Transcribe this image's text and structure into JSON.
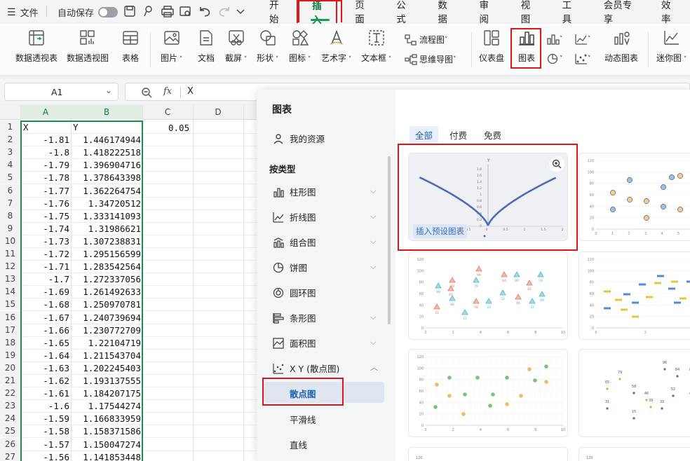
{
  "menubar": {
    "menu": "文件",
    "autosave": "自动保存"
  },
  "tabs": [
    "开始",
    "插入",
    "页面",
    "公式",
    "数据",
    "审阅",
    "视图",
    "工具",
    "会员专享",
    "效率"
  ],
  "ribbon": {
    "pivot_table": "数据透视表",
    "pivot_chart": "数据透视图",
    "table": "表格",
    "picture": "图片",
    "document": "文档",
    "screenshot": "截屏",
    "shape": "形状",
    "icon": "图标",
    "wordart": "艺术字",
    "textbox": "文本框",
    "flowchart": "流程图",
    "mindmap": "思维导图",
    "dashboard": "仪表盘",
    "chart": "图表",
    "dynamic_chart": "动态图表",
    "sparkline": "迷你图"
  },
  "formula_bar": {
    "cell_ref": "A1",
    "fx": "fx",
    "content": "X"
  },
  "sheet": {
    "col_headers": [
      "A",
      "B",
      "C",
      "D"
    ],
    "c1": "0.05",
    "rows": [
      {
        "n": "1",
        "a": "X",
        "b": "Y"
      },
      {
        "n": "2",
        "a": "-1.81",
        "b": "1.446174944"
      },
      {
        "n": "3",
        "a": "-1.8",
        "b": "1.418222518"
      },
      {
        "n": "4",
        "a": "-1.79",
        "b": "1.396904716"
      },
      {
        "n": "5",
        "a": "-1.78",
        "b": "1.378643398"
      },
      {
        "n": "6",
        "a": "-1.77",
        "b": "1.362264754"
      },
      {
        "n": "7",
        "a": "-1.76",
        "b": "1.34720512"
      },
      {
        "n": "8",
        "a": "-1.75",
        "b": "1.333141093"
      },
      {
        "n": "9",
        "a": "-1.74",
        "b": "1.31986621"
      },
      {
        "n": "10",
        "a": "-1.73",
        "b": "1.307238831"
      },
      {
        "n": "11",
        "a": "-1.72",
        "b": "1.295156599"
      },
      {
        "n": "12",
        "a": "-1.71",
        "b": "1.283542564"
      },
      {
        "n": "13",
        "a": "-1.7",
        "b": "1.272337056"
      },
      {
        "n": "14",
        "a": "-1.69",
        "b": "1.261492633"
      },
      {
        "n": "15",
        "a": "-1.68",
        "b": "1.250970781"
      },
      {
        "n": "16",
        "a": "-1.67",
        "b": "1.240739694"
      },
      {
        "n": "17",
        "a": "-1.66",
        "b": "1.230772709"
      },
      {
        "n": "18",
        "a": "-1.65",
        "b": "1.22104719"
      },
      {
        "n": "19",
        "a": "-1.64",
        "b": "1.211543704"
      },
      {
        "n": "20",
        "a": "-1.63",
        "b": "1.202245403"
      },
      {
        "n": "21",
        "a": "-1.62",
        "b": "1.193137555"
      },
      {
        "n": "22",
        "a": "-1.61",
        "b": "1.184207175"
      },
      {
        "n": "23",
        "a": "-1.6",
        "b": "1.17544274"
      },
      {
        "n": "24",
        "a": "-1.59",
        "b": "1.166833959"
      },
      {
        "n": "25",
        "a": "-1.58",
        "b": "1.158371586"
      },
      {
        "n": "26",
        "a": "-1.57",
        "b": "1.150047274"
      },
      {
        "n": "27",
        "a": "-1.56",
        "b": "1.141853448"
      }
    ]
  },
  "panel": {
    "title": "图表",
    "my_resources": "我的资源",
    "by_type": "按类型",
    "types": [
      "柱形图",
      "折线图",
      "组合图",
      "饼图",
      "圆环图",
      "条形图",
      "面积图"
    ],
    "xy_group": "X Y (散点图)",
    "xy_sub": [
      "散点图",
      "平滑线",
      "直线"
    ],
    "filters": [
      "全部",
      "付费",
      "免费"
    ],
    "insert_preset": "插入预设图表",
    "preview_title": "Y",
    "preview_yticks": [
      "1.8",
      "1.6",
      "1.4",
      "1.2",
      "1",
      "0.8",
      "0.6",
      "0.4",
      "0.2",
      "0"
    ],
    "preview_xticks": [
      "-1.5",
      "-1",
      "-0.5",
      "0",
      "0.5",
      "1",
      "1.5",
      "2"
    ],
    "thumb2": {
      "yticks": [
        "120",
        "100",
        "80",
        "60",
        "40",
        "20",
        "0"
      ],
      "xticks": [
        "0",
        "1",
        "2",
        "3",
        "4",
        "5",
        "6"
      ]
    },
    "thumb3": {
      "yticks": [
        "120",
        "100",
        "80",
        "60",
        "40",
        "20",
        "0"
      ],
      "xticks": [
        "0",
        "2",
        "4",
        "6",
        "8",
        "10"
      ],
      "tri_labels": [
        "88",
        "78",
        "46",
        "79",
        "96",
        "84",
        "80",
        "74",
        "82",
        "31",
        "58",
        "52",
        "46",
        "37",
        "33",
        "15",
        "49",
        "65"
      ]
    },
    "thumb4": {
      "yticks": [
        "120",
        "100",
        "80",
        "60",
        "40",
        "20",
        "0"
      ],
      "xticks": [
        "0",
        "2",
        "4"
      ]
    },
    "thumb5": {
      "yticks": [
        "120",
        "100",
        "80",
        "60",
        "40",
        "20",
        "0"
      ],
      "xticks": [
        "0",
        "2",
        "4",
        "6",
        "8",
        "10"
      ]
    },
    "thumb6": {
      "labels": [
        "96",
        "79",
        "84",
        "88",
        "65",
        "58",
        "52",
        "46",
        "46",
        "31",
        "39",
        "33",
        "15"
      ]
    },
    "thumb7": {
      "yticks": [
        "120"
      ]
    },
    "thumb8": {
      "yticks": [
        "120"
      ]
    }
  },
  "colors": {
    "accent": "#0f9d58",
    "red": "#e01515",
    "line": "#4b6cb7",
    "orange": "#e8a33c",
    "teal": "#4db6c9",
    "salmon": "#e07b5a"
  }
}
